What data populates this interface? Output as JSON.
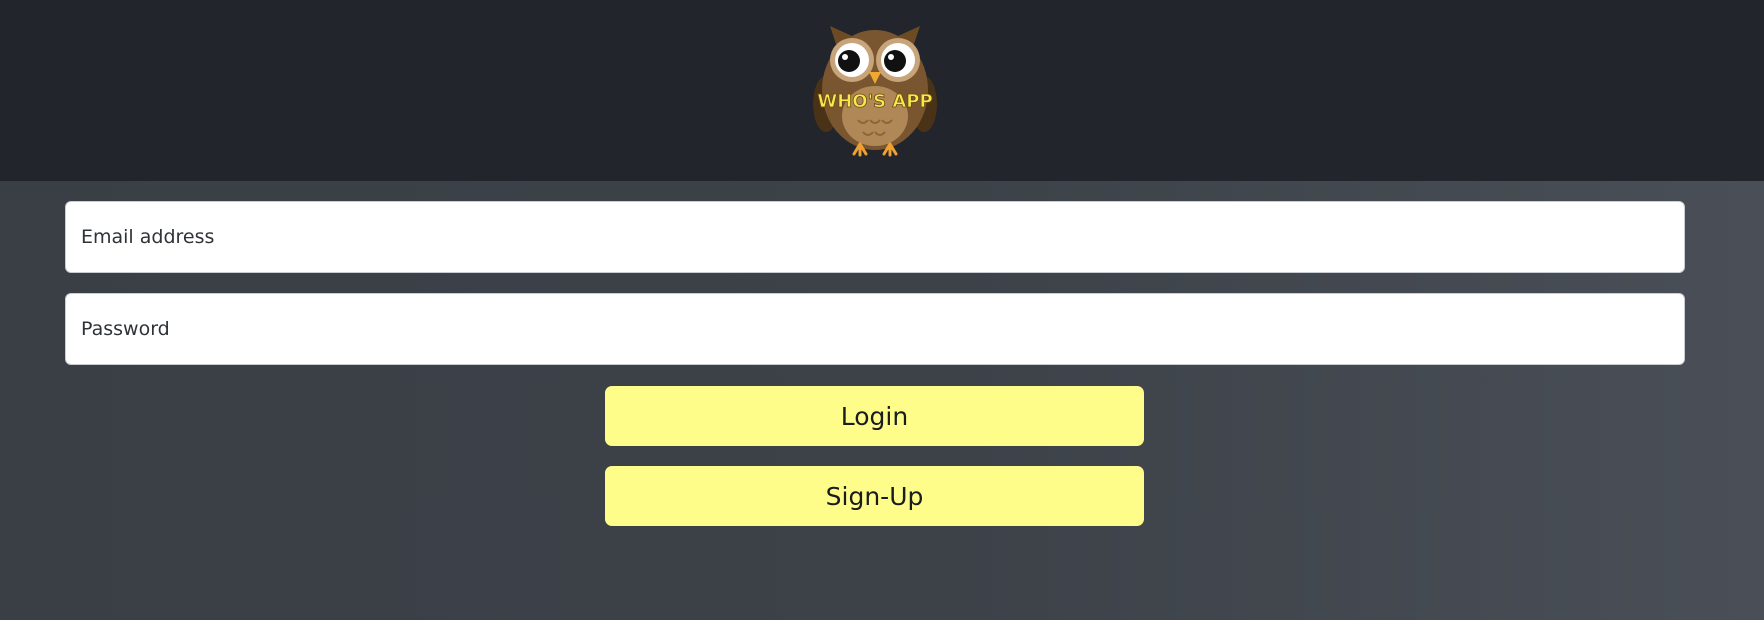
{
  "header": {
    "logo_text": "WHO'S APP",
    "logo_icon": "owl-icon"
  },
  "form": {
    "email_placeholder": "Email address",
    "password_placeholder": "Password",
    "login_label": "Login",
    "signup_label": "Sign-Up"
  },
  "colors": {
    "header_bg": "#22262c",
    "page_bg": "#3a3f46",
    "button_bg": "#fefd8a",
    "logo_text": "#f7e94a"
  }
}
